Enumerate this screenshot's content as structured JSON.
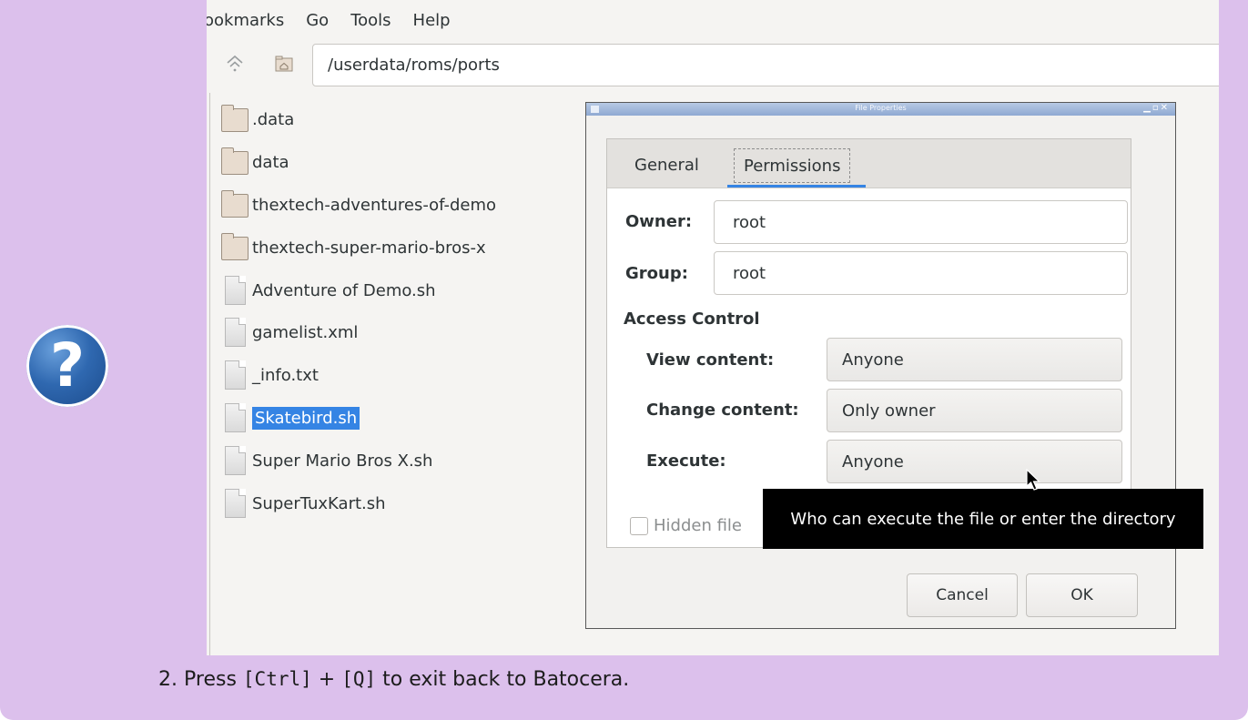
{
  "menubar": [
    "ookmarks",
    "Go",
    "Tools",
    "Help"
  ],
  "path": "/userdata/roms/ports",
  "files": [
    {
      "name": ".data",
      "type": "folder",
      "selected": false
    },
    {
      "name": "data",
      "type": "folder",
      "selected": false
    },
    {
      "name": "thextech-adventures-of-demo",
      "type": "folder",
      "selected": false
    },
    {
      "name": "thextech-super-mario-bros-x",
      "type": "folder",
      "selected": false
    },
    {
      "name": "Adventure of Demo.sh",
      "type": "file",
      "selected": false
    },
    {
      "name": "gamelist.xml",
      "type": "file",
      "selected": false
    },
    {
      "name": "_info.txt",
      "type": "file",
      "selected": false
    },
    {
      "name": "Skatebird.sh",
      "type": "file",
      "selected": true
    },
    {
      "name": "Super Mario Bros X.sh",
      "type": "file",
      "selected": false
    },
    {
      "name": "SuperTuxKart.sh",
      "type": "file",
      "selected": false
    }
  ],
  "dialog": {
    "title": "File Properties",
    "tabs": [
      "General",
      "Permissions"
    ],
    "active_tab": "Permissions",
    "owner_label": "Owner:",
    "owner_value": "root",
    "group_label": "Group:",
    "group_value": "root",
    "access_control_label": "Access Control",
    "view_label": "View content:",
    "view_value": "Anyone",
    "change_label": "Change content:",
    "change_value": "Only owner",
    "execute_label": "Execute:",
    "execute_value": "Anyone",
    "hidden_label": "Hidden file",
    "cancel_label": "Cancel",
    "ok_label": "OK"
  },
  "tooltip": "Who can execute the file or enter the directory",
  "help_icon": "question-mark-icon",
  "footer": {
    "number": "2.",
    "prefix": "Press",
    "key1": "[Ctrl]",
    "plus": "+",
    "key2": "[Q]",
    "suffix": "to exit back to Batocera."
  },
  "colors": {
    "note_background": "#dcc0ec",
    "selection": "#3584e4",
    "tab_underline": "#3584e4"
  }
}
